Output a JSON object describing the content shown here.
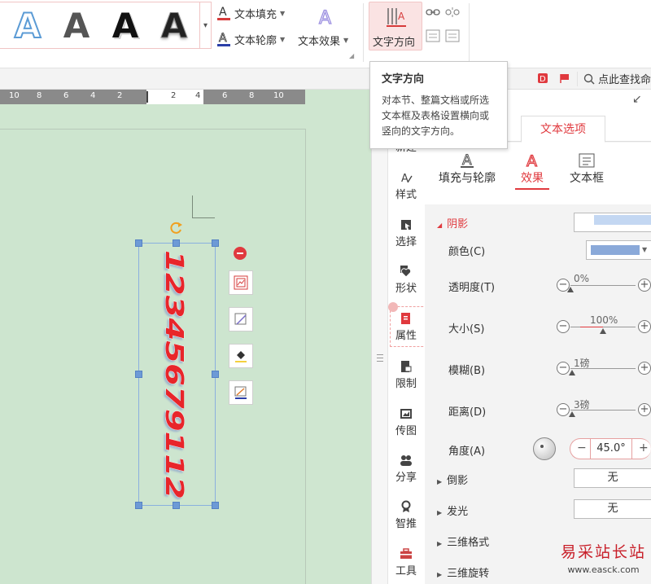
{
  "ribbon": {
    "gallery_glyph": "A",
    "text_fill": "文本填充",
    "text_outline": "文本轮廓",
    "text_effect": "文本效果",
    "text_direction": "文字方向",
    "accent": "#e0393e"
  },
  "tooltip": {
    "title": "文字方向",
    "body": "对本节、整篇文档或所选文本框及表格设置横向或竖向的文字方向。"
  },
  "strip": {
    "search_label": "点此查找命"
  },
  "ruler": {
    "labels": [
      "10",
      "8",
      "6",
      "4",
      "2",
      "2",
      "4",
      "6",
      "8",
      "10"
    ]
  },
  "textbox": {
    "text": "12345679112",
    "text_color": "#e8252a"
  },
  "sidebar": {
    "items": [
      {
        "label": "新建"
      },
      {
        "label": "样式"
      },
      {
        "label": "选择"
      },
      {
        "label": "形状"
      },
      {
        "label": "属性"
      },
      {
        "label": "限制"
      },
      {
        "label": "传图"
      },
      {
        "label": "分享"
      },
      {
        "label": "智推"
      },
      {
        "label": "工具"
      }
    ]
  },
  "panel": {
    "tab_text_options": "文本选项",
    "subtabs": [
      {
        "label": "填充与轮廓"
      },
      {
        "label": "效果"
      },
      {
        "label": "文本框"
      }
    ],
    "shadow": {
      "heading": "阴影",
      "color_label": "颜色(C)",
      "color_value": "#8aa9d9",
      "transparency_label": "透明度(T)",
      "transparency_value": "0%",
      "transparency_fraction": 0,
      "size_label": "大小(S)",
      "size_value": "100%",
      "size_fraction": 0.5,
      "blur_label": "模糊(B)",
      "blur_value": "1磅",
      "blur_fraction": 0.02,
      "distance_label": "距离(D)",
      "distance_value": "3磅",
      "distance_fraction": 0.02,
      "angle_label": "角度(A)",
      "angle_value": "45.0°"
    },
    "reflection": {
      "label": "倒影",
      "value": "无"
    },
    "glow": {
      "label": "发光",
      "value": "无"
    },
    "format3d": {
      "label": "三维格式"
    },
    "rotate3d": {
      "label": "三维旋转"
    }
  },
  "watermark": {
    "title": "易采站长站",
    "url": "www.easck.com"
  }
}
